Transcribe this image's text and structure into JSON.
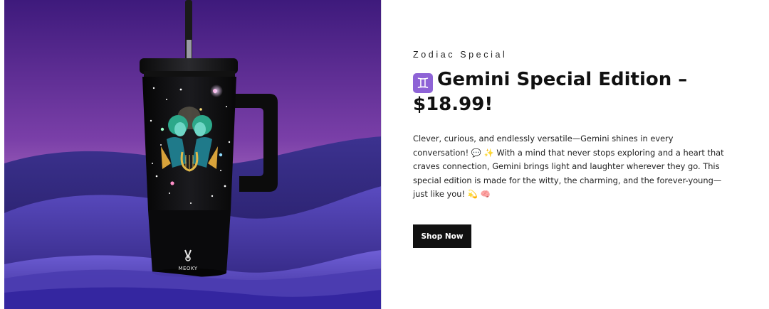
{
  "hero": {
    "image_alt": "Black MEOKY tumbler with Gemini twins artwork on purple desert dunes",
    "brand_mark": "MEOKY"
  },
  "product": {
    "eyebrow": "Zodiac Special",
    "zodiac_glyph": "♊",
    "title": "Gemini Special Edition – $18.99!",
    "description": "Clever, curious, and endlessly versatile—Gemini shines in every conversation! 💬 ✨ With a mind that never stops exploring and a heart that craves connection, Gemini brings light and laughter wherever they go. This special edition is made for the witty, the charming, and the forever-young—just like you! 💫 🧠",
    "cta_label": "Shop Now"
  },
  "colors": {
    "accent": "#8e63d6",
    "button_bg": "#111111",
    "sky_top": "#4a1f8a",
    "sky_bottom": "#d49ed8",
    "dune": "#3a2a8a"
  }
}
